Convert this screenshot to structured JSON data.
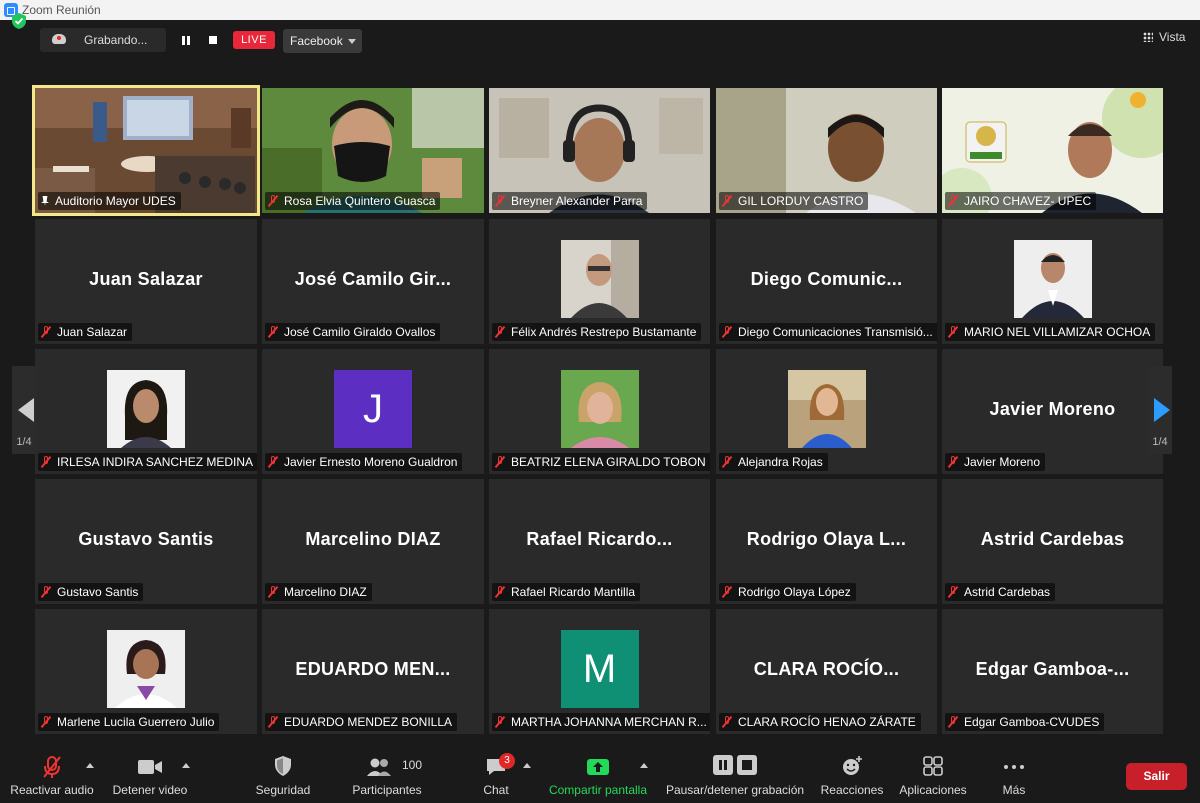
{
  "window": {
    "title": "Zoom Reunión"
  },
  "topbar": {
    "recording_label": "Grabando...",
    "live_label": "LIVE",
    "stream_target": "Facebook",
    "view_label": "Vista"
  },
  "pagination": {
    "left": "1/4",
    "right": "1/4"
  },
  "tiles": [
    {
      "display_name": "",
      "label": "Auditorio Mayor UDES"
    },
    {
      "display_name": "",
      "label": "Rosa Elvia Quintero Guasca"
    },
    {
      "display_name": "",
      "label": "Breyner Alexander Parra"
    },
    {
      "display_name": "",
      "label": "GIL LORDUY CASTRO"
    },
    {
      "display_name": "",
      "label": "JAIRO CHAVEZ- UPEC"
    },
    {
      "display_name": "Juan Salazar",
      "label": "Juan Salazar"
    },
    {
      "display_name": "José Camilo Gir...",
      "label": "José Camilo Giraldo Ovallos"
    },
    {
      "display_name": "",
      "label": "Félix Andrés Restrepo Bustamante"
    },
    {
      "display_name": "Diego Comunic...",
      "label": "Diego Comunicaciones Transmisió..."
    },
    {
      "display_name": "",
      "label": "MARIO NEL VILLAMIZAR OCHOA"
    },
    {
      "display_name": "",
      "label": "IRLESA INDIRA SANCHEZ MEDINA"
    },
    {
      "display_name": "J",
      "label": "Javier Ernesto Moreno Gualdron"
    },
    {
      "display_name": "",
      "label": "BEATRIZ ELENA GIRALDO TOBON"
    },
    {
      "display_name": "",
      "label": "Alejandra Rojas"
    },
    {
      "display_name": "Javier Moreno",
      "label": "Javier Moreno"
    },
    {
      "display_name": "Gustavo Santis",
      "label": "Gustavo Santis"
    },
    {
      "display_name": "Marcelino DIAZ",
      "label": "Marcelino DIAZ"
    },
    {
      "display_name": "Rafael Ricardo...",
      "label": "Rafael Ricardo Mantilla"
    },
    {
      "display_name": "Rodrigo Olaya L...",
      "label": "Rodrigo Olaya López"
    },
    {
      "display_name": "Astrid Cardebas",
      "label": "Astrid Cardebas"
    },
    {
      "display_name": "",
      "label": "Marlene Lucila Guerrero Julio"
    },
    {
      "display_name": "EDUARDO MEN...",
      "label": "EDUARDO MENDEZ BONILLA"
    },
    {
      "display_name": "M",
      "label": "MARTHA JOHANNA MERCHAN R..."
    },
    {
      "display_name": "CLARA ROCÍO...",
      "label": "CLARA ROCÍO HENAO ZÁRATE"
    },
    {
      "display_name": "Edgar Gamboa-...",
      "label": "Edgar Gamboa-CVUDES"
    }
  ],
  "toolbar": {
    "unmute": "Reactivar audio",
    "stop_video": "Detener video",
    "security": "Seguridad",
    "participants": "Participantes",
    "participants_count": "100",
    "chat": "Chat",
    "chat_badge": "3",
    "share": "Compartir pantalla",
    "record": "Pausar/detener grabación",
    "reactions": "Reacciones",
    "apps": "Aplicaciones",
    "more": "Más",
    "leave": "Salir"
  },
  "colors": {
    "active_speaker": "#f3e98a",
    "live": "#e8283a",
    "leave": "#c8202a",
    "share": "#23d959",
    "letter_j": "#5c2fc2",
    "letter_m": "#0f8f74"
  }
}
